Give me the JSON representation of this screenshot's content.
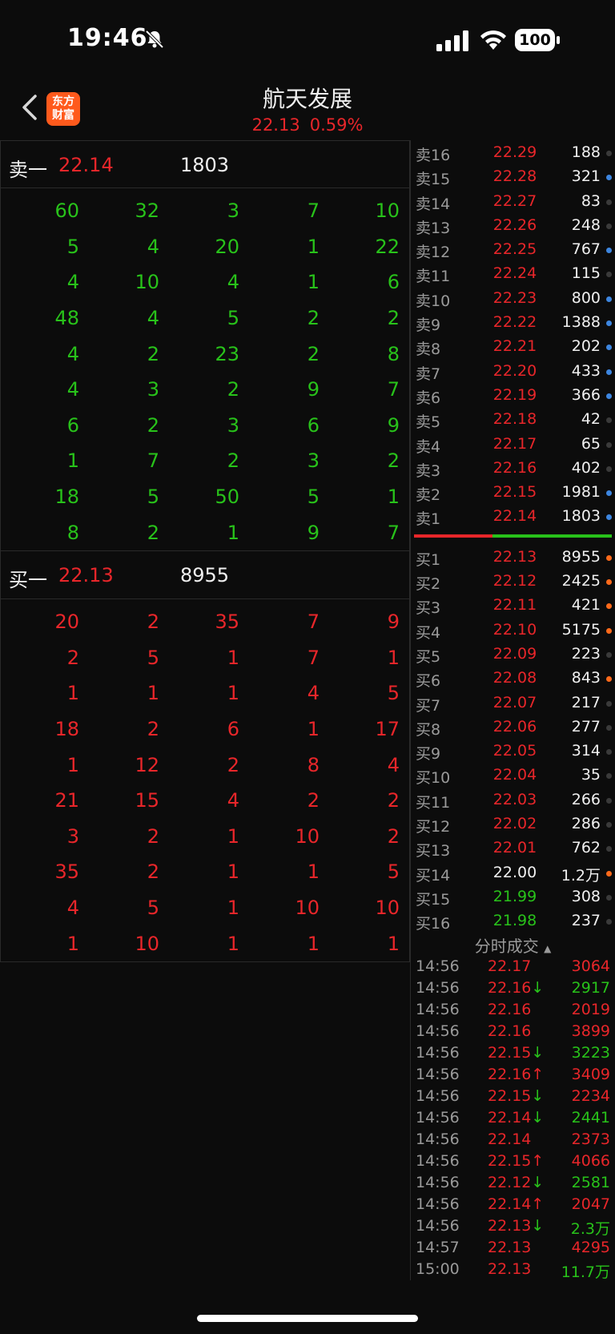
{
  "status": {
    "time": "19:46",
    "battery": "100"
  },
  "header": {
    "title": "航天发展",
    "price": "22.13",
    "change_pct": "0.59%",
    "logo_line1": "东方",
    "logo_line2": "财富"
  },
  "sell_one": {
    "label": "卖一",
    "price": "22.14",
    "volume": "1803"
  },
  "buy_one": {
    "label": "买一",
    "price": "22.13",
    "volume": "8955"
  },
  "sell_queue": [
    [
      "60",
      "32",
      "3",
      "7",
      "10"
    ],
    [
      "5",
      "4",
      "20",
      "1",
      "22"
    ],
    [
      "4",
      "10",
      "4",
      "1",
      "6"
    ],
    [
      "48",
      "4",
      "5",
      "2",
      "2"
    ],
    [
      "4",
      "2",
      "23",
      "2",
      "8"
    ],
    [
      "4",
      "3",
      "2",
      "9",
      "7"
    ],
    [
      "6",
      "2",
      "3",
      "6",
      "9"
    ],
    [
      "1",
      "7",
      "2",
      "3",
      "2"
    ],
    [
      "18",
      "5",
      "50",
      "5",
      "1"
    ],
    [
      "8",
      "2",
      "1",
      "9",
      "7"
    ]
  ],
  "buy_queue": [
    [
      "20",
      "2",
      "35",
      "7",
      "9"
    ],
    [
      "2",
      "5",
      "1",
      "7",
      "1"
    ],
    [
      "1",
      "1",
      "1",
      "4",
      "5"
    ],
    [
      "18",
      "2",
      "6",
      "1",
      "17"
    ],
    [
      "1",
      "12",
      "2",
      "8",
      "4"
    ],
    [
      "21",
      "15",
      "4",
      "2",
      "2"
    ],
    [
      "3",
      "2",
      "1",
      "10",
      "2"
    ],
    [
      "35",
      "2",
      "1",
      "1",
      "5"
    ],
    [
      "4",
      "5",
      "1",
      "10",
      "10"
    ],
    [
      "1",
      "10",
      "1",
      "1",
      "1"
    ]
  ],
  "asks": [
    {
      "label": "卖16",
      "price": "22.29",
      "vol": "188",
      "dot": "gray"
    },
    {
      "label": "卖15",
      "price": "22.28",
      "vol": "321",
      "dot": "blue"
    },
    {
      "label": "卖14",
      "price": "22.27",
      "vol": "83",
      "dot": "gray"
    },
    {
      "label": "卖13",
      "price": "22.26",
      "vol": "248",
      "dot": "gray"
    },
    {
      "label": "卖12",
      "price": "22.25",
      "vol": "767",
      "dot": "blue"
    },
    {
      "label": "卖11",
      "price": "22.24",
      "vol": "115",
      "dot": "gray"
    },
    {
      "label": "卖10",
      "price": "22.23",
      "vol": "800",
      "dot": "blue"
    },
    {
      "label": "卖9",
      "price": "22.22",
      "vol": "1388",
      "dot": "blue"
    },
    {
      "label": "卖8",
      "price": "22.21",
      "vol": "202",
      "dot": "blue"
    },
    {
      "label": "卖7",
      "price": "22.20",
      "vol": "433",
      "dot": "blue"
    },
    {
      "label": "卖6",
      "price": "22.19",
      "vol": "366",
      "dot": "blue"
    },
    {
      "label": "卖5",
      "price": "22.18",
      "vol": "42",
      "dot": "gray"
    },
    {
      "label": "卖4",
      "price": "22.17",
      "vol": "65",
      "dot": "gray"
    },
    {
      "label": "卖3",
      "price": "22.16",
      "vol": "402",
      "dot": "gray"
    },
    {
      "label": "卖2",
      "price": "22.15",
      "vol": "1981",
      "dot": "blue"
    },
    {
      "label": "卖1",
      "price": "22.14",
      "vol": "1803",
      "dot": "blue"
    }
  ],
  "bids": [
    {
      "label": "买1",
      "price": "22.13",
      "vol": "8955",
      "dot": "orange",
      "color": "red"
    },
    {
      "label": "买2",
      "price": "22.12",
      "vol": "2425",
      "dot": "orange",
      "color": "red"
    },
    {
      "label": "买3",
      "price": "22.11",
      "vol": "421",
      "dot": "orange",
      "color": "red"
    },
    {
      "label": "买4",
      "price": "22.10",
      "vol": "5175",
      "dot": "orange",
      "color": "red"
    },
    {
      "label": "买5",
      "price": "22.09",
      "vol": "223",
      "dot": "gray",
      "color": "red"
    },
    {
      "label": "买6",
      "price": "22.08",
      "vol": "843",
      "dot": "orange",
      "color": "red"
    },
    {
      "label": "买7",
      "price": "22.07",
      "vol": "217",
      "dot": "gray",
      "color": "red"
    },
    {
      "label": "买8",
      "price": "22.06",
      "vol": "277",
      "dot": "gray",
      "color": "red"
    },
    {
      "label": "买9",
      "price": "22.05",
      "vol": "314",
      "dot": "gray",
      "color": "red"
    },
    {
      "label": "买10",
      "price": "22.04",
      "vol": "35",
      "dot": "gray",
      "color": "red"
    },
    {
      "label": "买11",
      "price": "22.03",
      "vol": "266",
      "dot": "gray",
      "color": "red"
    },
    {
      "label": "买12",
      "price": "22.02",
      "vol": "286",
      "dot": "gray",
      "color": "red"
    },
    {
      "label": "买13",
      "price": "22.01",
      "vol": "762",
      "dot": "gray",
      "color": "red"
    },
    {
      "label": "买14",
      "price": "22.00",
      "vol": "1.2万",
      "dot": "orange",
      "color": "white"
    },
    {
      "label": "买15",
      "price": "21.99",
      "vol": "308",
      "dot": "gray",
      "color": "green"
    },
    {
      "label": "买16",
      "price": "21.98",
      "vol": "237",
      "dot": "gray",
      "color": "green"
    }
  ],
  "ticks_header": "分时成交",
  "ticks": [
    {
      "time": "14:56",
      "price": "22.17",
      "arrow": "",
      "vol": "3064",
      "vcolor": "red"
    },
    {
      "time": "14:56",
      "price": "22.16",
      "arrow": "↓",
      "vol": "2917",
      "vcolor": "green"
    },
    {
      "time": "14:56",
      "price": "22.16",
      "arrow": "",
      "vol": "2019",
      "vcolor": "red"
    },
    {
      "time": "14:56",
      "price": "22.16",
      "arrow": "",
      "vol": "3899",
      "vcolor": "red"
    },
    {
      "time": "14:56",
      "price": "22.15",
      "arrow": "↓",
      "vol": "3223",
      "vcolor": "green"
    },
    {
      "time": "14:56",
      "price": "22.16",
      "arrow": "↑",
      "vol": "3409",
      "vcolor": "red"
    },
    {
      "time": "14:56",
      "price": "22.15",
      "arrow": "↓",
      "vol": "2234",
      "vcolor": "red"
    },
    {
      "time": "14:56",
      "price": "22.14",
      "arrow": "↓",
      "vol": "2441",
      "vcolor": "green"
    },
    {
      "time": "14:56",
      "price": "22.14",
      "arrow": "",
      "vol": "2373",
      "vcolor": "red"
    },
    {
      "time": "14:56",
      "price": "22.15",
      "arrow": "↑",
      "vol": "4066",
      "vcolor": "red"
    },
    {
      "time": "14:56",
      "price": "22.12",
      "arrow": "↓",
      "vol": "2581",
      "vcolor": "green"
    },
    {
      "time": "14:56",
      "price": "22.14",
      "arrow": "↑",
      "vol": "2047",
      "vcolor": "red"
    },
    {
      "time": "14:56",
      "price": "22.13",
      "arrow": "↓",
      "vol": "2.3万",
      "vcolor": "green"
    },
    {
      "time": "14:57",
      "price": "22.13",
      "arrow": "",
      "vol": "4295",
      "vcolor": "red"
    },
    {
      "time": "15:00",
      "price": "22.13",
      "arrow": "",
      "vol": "11.7万",
      "vcolor": "green"
    }
  ]
}
